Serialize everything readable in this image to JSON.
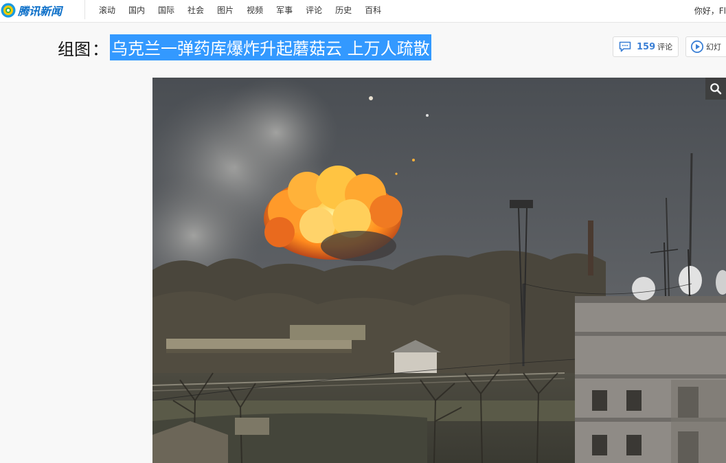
{
  "logo": {
    "text": "腾讯新闻"
  },
  "nav": {
    "items": [
      "滚动",
      "国内",
      "国际",
      "社会",
      "图片",
      "视频",
      "军事",
      "评论",
      "历史",
      "百科"
    ]
  },
  "user": {
    "greeting": "你好，Fl"
  },
  "article": {
    "title_prefix": "组图",
    "title_colon": "：",
    "title": "乌克兰一弹药库爆炸升起蘑菇云 上万人疏散"
  },
  "actions": {
    "comments_count": "159",
    "comments_label": "评论",
    "slideshow_label": "幻灯"
  },
  "colors": {
    "selection": "#3399ff",
    "accent": "#3a7fd5",
    "logo": "#0a6ec8"
  },
  "icons": {
    "logo": "tencent-logo-icon",
    "comment": "comment-bubble-icon",
    "slideshow": "play-circle-icon",
    "zoom": "magnifier-icon"
  }
}
